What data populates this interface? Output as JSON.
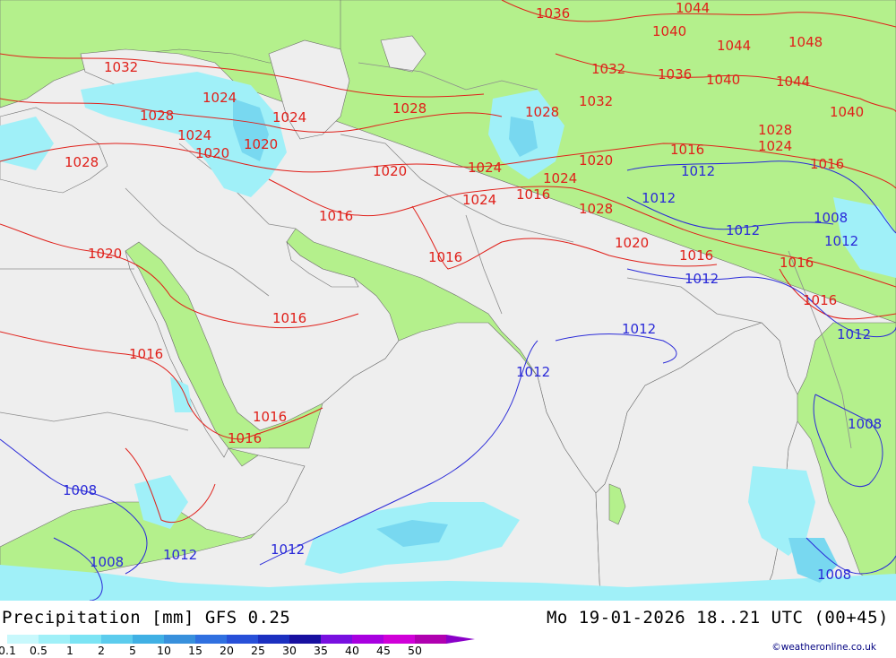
{
  "title": {
    "left": "Precipitation [mm]  GFS 0.25",
    "right": "Mo 19-01-2026 18..21 UTC (00+45)"
  },
  "credit": "©weatheronline.co.uk",
  "colors": {
    "land": "#b4f08c",
    "sea": "#eeeeee",
    "border": "#8c8c8c",
    "isobar_high": "#e0201a",
    "isobar_low": "#2a2ad8",
    "precip_light": "#a0f0f8",
    "precip_medium": "#78d8f0"
  },
  "scale": {
    "labels": [
      "0.1",
      "0.5",
      "1",
      "2",
      "5",
      "10",
      "15",
      "20",
      "25",
      "30",
      "35",
      "40",
      "45",
      "50"
    ],
    "colors": [
      "#c8f8fc",
      "#a0f0f8",
      "#7ce4f4",
      "#5ccced",
      "#40b0e4",
      "#3890dc",
      "#3070e0",
      "#2850d8",
      "#1c30c0",
      "#1810a0",
      "#7810e0",
      "#a800e0",
      "#d000d8",
      "#b000b0"
    ]
  },
  "isobar_labels": [
    {
      "text": "1036"
    },
    {
      "text": "1044"
    },
    {
      "text": "1040"
    },
    {
      "text": "1044"
    },
    {
      "text": "1048"
    },
    {
      "text": "1032"
    },
    {
      "text": "1036"
    },
    {
      "text": "1040"
    },
    {
      "text": "1044"
    },
    {
      "text": "1032"
    },
    {
      "text": "1040"
    },
    {
      "text": "1028"
    },
    {
      "text": "1032"
    },
    {
      "text": "1028"
    },
    {
      "text": "1024"
    },
    {
      "text": "1024"
    },
    {
      "text": "1028"
    },
    {
      "text": "1024"
    },
    {
      "text": "1020"
    },
    {
      "text": "1020"
    },
    {
      "text": "1028"
    },
    {
      "text": "1020"
    },
    {
      "text": "1024"
    },
    {
      "text": "1020"
    },
    {
      "text": "1016"
    },
    {
      "text": "1016"
    },
    {
      "text": "1024"
    },
    {
      "text": "1016"
    },
    {
      "text": "1024"
    },
    {
      "text": "1028"
    },
    {
      "text": "1016"
    },
    {
      "text": "1020"
    },
    {
      "text": "1020"
    },
    {
      "text": "1016"
    },
    {
      "text": "1016"
    },
    {
      "text": "1016"
    },
    {
      "text": "1016"
    },
    {
      "text": "1016"
    },
    {
      "text": "1016"
    },
    {
      "text": "1016"
    },
    {
      "text": "1016"
    },
    {
      "text": "1028"
    },
    {
      "text": "1024"
    }
  ],
  "isobar_labels_low": [
    {
      "text": "1012"
    },
    {
      "text": "1012"
    },
    {
      "text": "1008"
    },
    {
      "text": "1012"
    },
    {
      "text": "1012"
    },
    {
      "text": "1012"
    },
    {
      "text": "1012"
    },
    {
      "text": "1012"
    },
    {
      "text": "1012"
    },
    {
      "text": "1008"
    },
    {
      "text": "1008"
    },
    {
      "text": "1008"
    },
    {
      "text": "1012"
    },
    {
      "text": "1012"
    },
    {
      "text": "1008"
    }
  ]
}
